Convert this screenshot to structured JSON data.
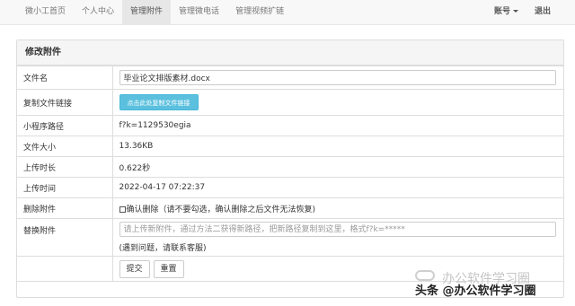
{
  "navbar": {
    "items": [
      {
        "label": "微小工首页",
        "active": false
      },
      {
        "label": "个人中心",
        "active": false
      },
      {
        "label": "管理附件",
        "active": true
      },
      {
        "label": "管理微电话",
        "active": false
      },
      {
        "label": "管理视频扩链",
        "active": false
      }
    ],
    "account_label": "账号",
    "logout_label": "退出"
  },
  "panel": {
    "title": "修改附件",
    "rows": {
      "filename_label": "文件名",
      "filename_value": "毕业论文排版素材.docx",
      "copy_link_label": "复制文件链接",
      "copy_link_button": "点击此处复制文件链接",
      "miniprogram_path_label": "小程序路径",
      "miniprogram_path_value": "f?k=1129530egia",
      "file_size_label": "文件大小",
      "file_size_value": "13.36KB",
      "upload_duration_label": "上传时长",
      "upload_duration_value": "0.622秒",
      "upload_time_label": "上传时间",
      "upload_time_value": "2022-04-17 07:22:37",
      "delete_label": "删除附件",
      "delete_checkbox_text": "确认删除（请不要勾选，确认删除之后文件无法恢复)",
      "replace_label": "替换附件",
      "replace_placeholder": "请上传新附件，通过方法二获得新路径，把新路径复制到这里，格式f?k=*****",
      "replace_help": "(遇到问题，请联系客服)",
      "submit_label": "提交",
      "reset_label": "重置"
    }
  },
  "watermark": {
    "faint_text": "办公软件学习圈",
    "main_text": "头条 @办公软件学习圈"
  }
}
